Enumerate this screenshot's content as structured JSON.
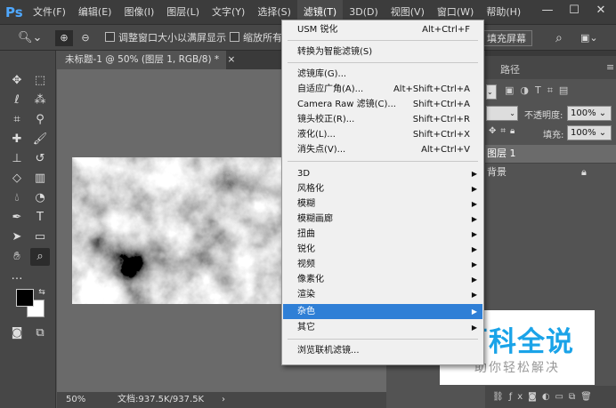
{
  "app": {
    "logo": "Ps"
  },
  "menubar": {
    "items": [
      "文件(F)",
      "编辑(E)",
      "图像(I)",
      "图层(L)",
      "文字(Y)",
      "选择(S)",
      "滤镜(T)",
      "3D(D)",
      "视图(V)",
      "窗口(W)",
      "帮助(H)"
    ],
    "active_index": 6
  },
  "options": {
    "resize_windows": "调整窗口大小以满屏显示",
    "zoom_all": "缩放所有窗",
    "fill_screen": "填充屏幕"
  },
  "document": {
    "tab_title": "未标题-1 @ 50% (图层 1, RGB/8) *",
    "close_icon": "×",
    "zoom": "50%",
    "doc_info": "文档:937.5K/937.5K"
  },
  "filter_menu": {
    "items": [
      {
        "label": "USM 锐化",
        "shortcut": "Alt+Ctrl+F"
      },
      {
        "label": "转换为智能滤镜(S)",
        "shortcut": ""
      },
      {
        "label": "滤镜库(G)...",
        "shortcut": ""
      },
      {
        "label": "自适应广角(A)...",
        "shortcut": "Alt+Shift+Ctrl+A"
      },
      {
        "label": "Camera Raw 滤镜(C)...",
        "shortcut": "Shift+Ctrl+A"
      },
      {
        "label": "镜头校正(R)...",
        "shortcut": "Shift+Ctrl+R"
      },
      {
        "label": "液化(L)...",
        "shortcut": "Shift+Ctrl+X"
      },
      {
        "label": "消失点(V)...",
        "shortcut": "Alt+Ctrl+V"
      },
      {
        "label": "3D",
        "submenu": true
      },
      {
        "label": "风格化",
        "submenu": true
      },
      {
        "label": "模糊",
        "submenu": true
      },
      {
        "label": "模糊画廊",
        "submenu": true
      },
      {
        "label": "扭曲",
        "submenu": true
      },
      {
        "label": "锐化",
        "submenu": true
      },
      {
        "label": "视频",
        "submenu": true
      },
      {
        "label": "像素化",
        "submenu": true
      },
      {
        "label": "渲染",
        "submenu": true
      },
      {
        "label": "杂色",
        "submenu": true,
        "highlighted": true
      },
      {
        "label": "其它",
        "submenu": true
      },
      {
        "label": "浏览联机滤镜...",
        "shortcut": ""
      }
    ]
  },
  "panels": {
    "tab_paths": "路径",
    "opacity_label": "不透明度:",
    "opacity_value": "100%",
    "fill_label": "填充:",
    "fill_value": "100%",
    "layers": [
      {
        "name": "图层 1"
      },
      {
        "name": "背景"
      }
    ]
  },
  "watermark": {
    "title": "百科全说",
    "subtitle": "助你轻松解决"
  },
  "colors": {
    "highlight": "#2f7fd6",
    "watermark_blue": "#1aa3e8"
  }
}
